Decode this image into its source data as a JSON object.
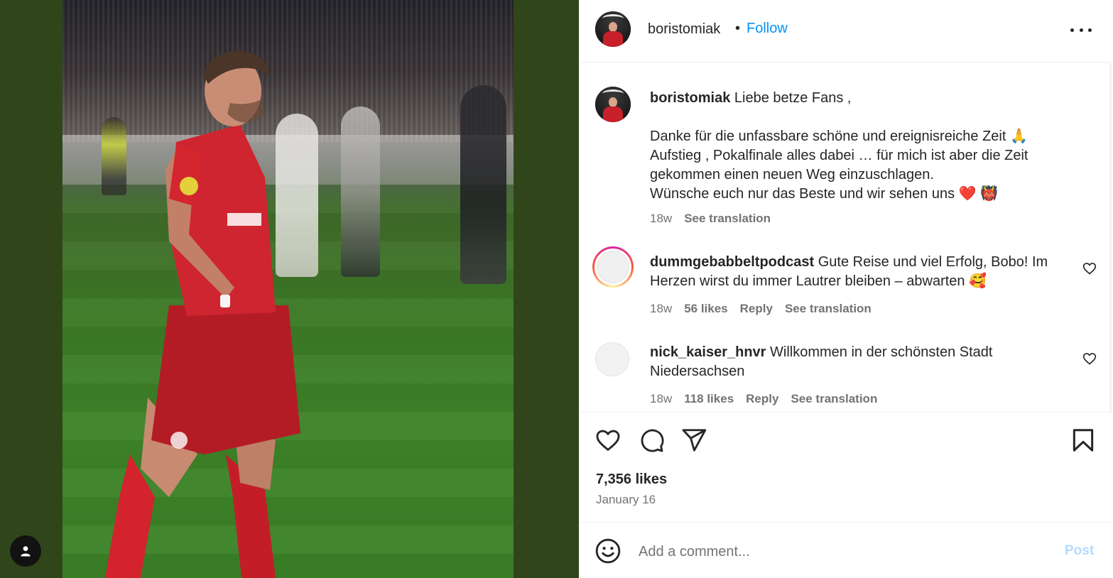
{
  "post": {
    "author": "boristomiak",
    "separator": "•",
    "follow_label": "Follow",
    "more_icon": "more-horizontal-icon",
    "caption": {
      "username": "boristomiak",
      "line1": "Liebe betze Fans ,",
      "line2": "Danke für die unfassbare schöne und ereignisreiche Zeit 🙏",
      "line3": "Aufstieg , Pokalfinale alles dabei … für mich ist aber die Zeit",
      "line4": "gekommen einen neuen Weg einzuschlagen.",
      "line5": "Wünsche euch nur das Beste und wir sehen uns ❤️ 👹",
      "time": "18w",
      "translation_label": "See translation"
    },
    "comments": [
      {
        "username": "dummgebabbeltpodcast",
        "text_line1": "Gute Reise und viel Erfolg, Bobo! Im",
        "text_line2": "Herzen wirst du immer Lautrer bleiben – abwarten 🥰",
        "time": "18w",
        "likes": "56 likes",
        "reply_label": "Reply",
        "translation_label": "See translation"
      },
      {
        "username": "nick_kaiser_hnvr",
        "text_line1": "Willkommen in der schönsten Stadt",
        "text_line2": "Niedersachsen",
        "time": "18w",
        "likes": "118 likes",
        "reply_label": "Reply",
        "translation_label": "See translation"
      }
    ],
    "likes_count": "7,356 likes",
    "date": "January 16",
    "comment_placeholder": "Add a comment...",
    "post_label": "Post"
  },
  "colors": {
    "accent_blue": "#0095f6",
    "post_disabled": "#b3dbff",
    "left_backdrop": "#31451a",
    "jersey_red": "#c8202a"
  }
}
